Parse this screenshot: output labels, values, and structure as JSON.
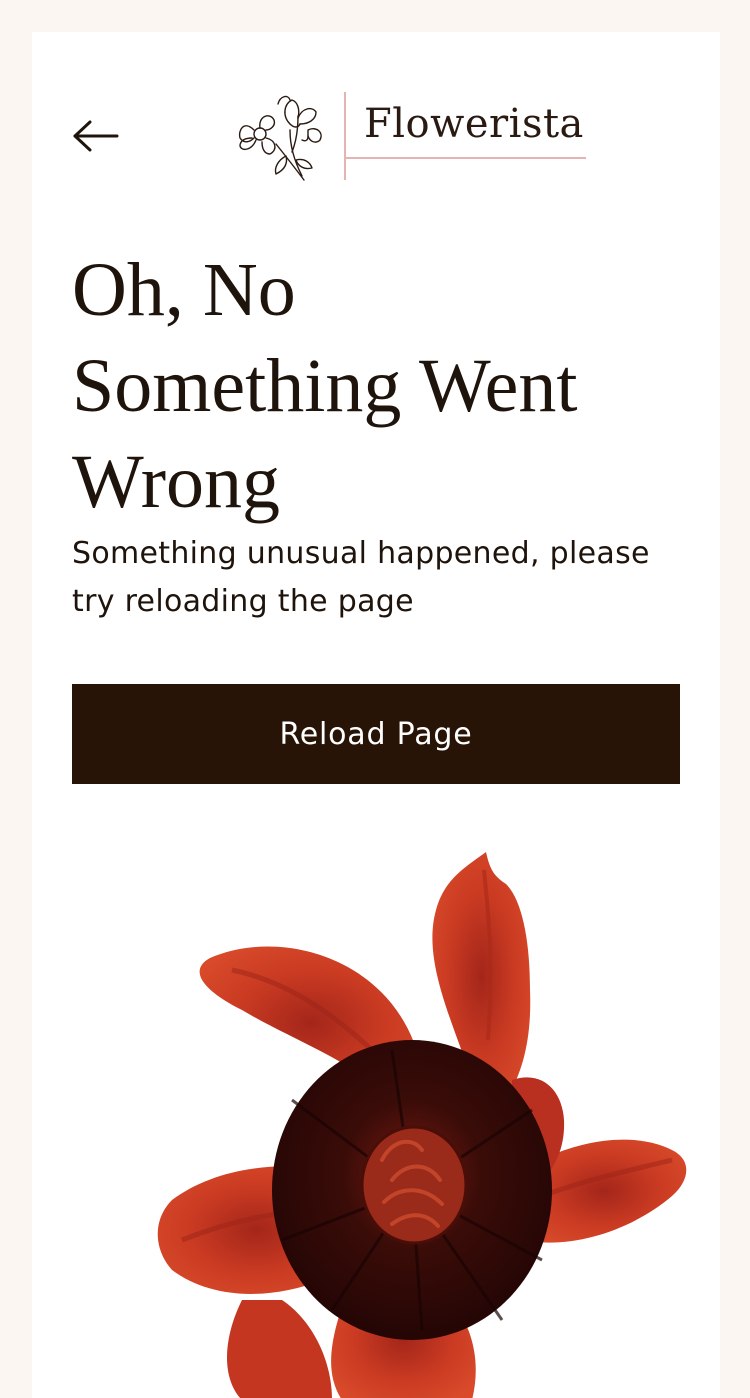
{
  "header": {
    "back_icon": "arrow-left-icon",
    "logo_icon": "flower-sketch-icon",
    "brand_name": "Flowerista"
  },
  "error": {
    "title_lines": [
      "Oh, No",
      "Something Went",
      "Wrong"
    ],
    "message": "Something unusual happened, please try reloading the page",
    "reload_label": "Reload Page"
  },
  "illustration": {
    "icon": "red-poppy-flower-illustration"
  },
  "colors": {
    "page_background": "#fbf6f1",
    "card_background": "#ffffff",
    "text_dark": "#1f140c",
    "button_background": "#281406",
    "button_text": "#ffffff",
    "logo_accent": "#e6b3b3",
    "flower_red": "#c93a22",
    "flower_center": "#2e0a08"
  }
}
